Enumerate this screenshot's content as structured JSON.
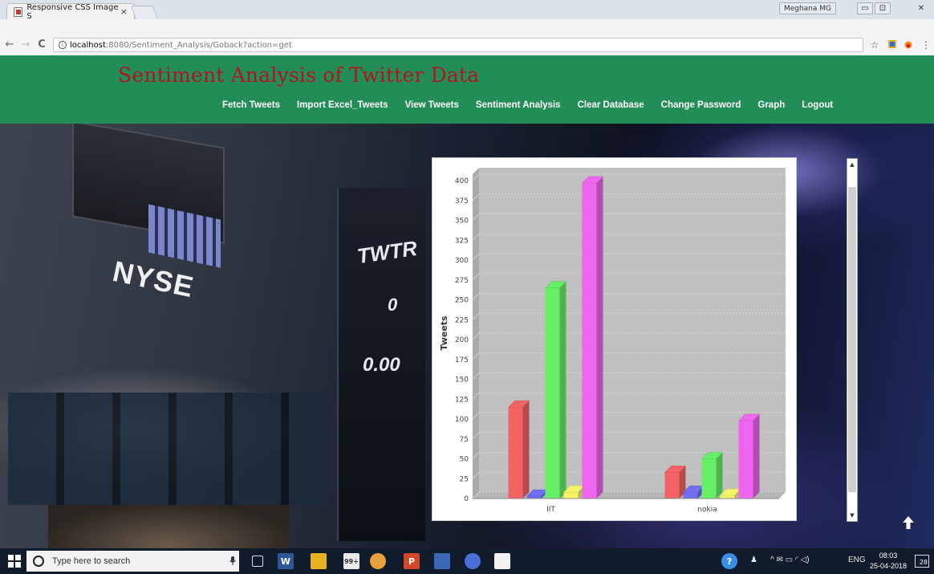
{
  "browser": {
    "tab_title": "Responsive CSS Image S",
    "tab_close": "×",
    "user_name": "Meghana MG",
    "url_host": "localhost",
    "url_path": ":8080/Sentiment_Analysis/Goback?action=get",
    "back": "←",
    "forward": "→",
    "reload": "C",
    "star": "☆",
    "menu": "⋮",
    "info": "i",
    "minimize": "▭",
    "maximize": "⊡",
    "close": "✕"
  },
  "site": {
    "title": "Sentiment Analysis of Twitter Data",
    "nav": [
      "Fetch Tweets",
      "Import Excel_Tweets",
      "View Tweets",
      "Sentiment Analysis",
      "Clear Database",
      "Change Password",
      "Graph",
      "Logout"
    ]
  },
  "photo_text": {
    "nyse": "NYSE",
    "twtr": "TWTR",
    "zero": "0",
    "price": "0.00"
  },
  "chart_data": {
    "type": "bar",
    "categories": [
      "IIT",
      "nokia"
    ],
    "ylabel": "Tweets",
    "ylim": [
      0,
      400
    ],
    "yticks": [
      "0",
      "25",
      "50",
      "75",
      "100",
      "125",
      "150",
      "175",
      "200",
      "225",
      "250",
      "275",
      "300",
      "325",
      "350",
      "375",
      "400"
    ],
    "series": [
      {
        "values": [
          115,
          33
        ],
        "color": "#f26464"
      },
      {
        "values": [
          3,
          8
        ],
        "color": "#6f6ff0"
      },
      {
        "values": [
          265,
          50
        ],
        "color": "#66ee66"
      },
      {
        "values": [
          8,
          4
        ],
        "color": "#f3f366"
      },
      {
        "values": [
          397,
          98
        ],
        "color": "#ee66ee"
      }
    ],
    "grid": true,
    "legend": "none"
  },
  "scrollbar": {
    "up": "▲",
    "down": "▼"
  },
  "to_top": "🡅",
  "taskbar": {
    "search_placeholder": "Type here to search",
    "mic": "🎙",
    "badge": "99+",
    "tray_lang": "ENG",
    "tray_icons": "^ ✉ ▭ ◜ ◁)",
    "time": "08:03",
    "date": "25-04-2018",
    "notifications": "28"
  }
}
